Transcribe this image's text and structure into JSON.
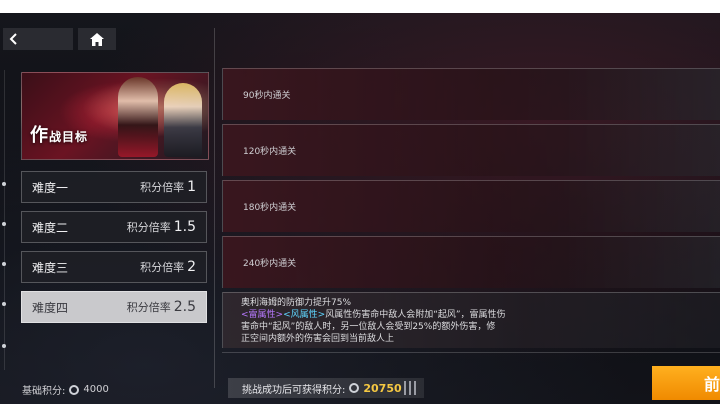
{
  "nav": {
    "back_icon": "chevron-left-icon",
    "home_icon": "home-icon"
  },
  "objective": {
    "title_big": "作",
    "title_rest": "战目标"
  },
  "difficulties": [
    {
      "name": "难度一",
      "multiplier_label": "积分倍率",
      "multiplier": "1",
      "selected": false
    },
    {
      "name": "难度二",
      "multiplier_label": "积分倍率",
      "multiplier": "1.5",
      "selected": false
    },
    {
      "name": "难度三",
      "multiplier_label": "积分倍率",
      "multiplier": "2",
      "selected": false
    },
    {
      "name": "难度四",
      "multiplier_label": "积分倍率",
      "multiplier": "2.5",
      "selected": true
    }
  ],
  "goals": [
    {
      "label": "90秒内通关"
    },
    {
      "label": "120秒内通关"
    },
    {
      "label": "180秒内通关"
    },
    {
      "label": "240秒内通关"
    }
  ],
  "description": {
    "line1": "奥利海姆的防御力提升75%",
    "tag_lightning": "<雷属性>",
    "tag_wind": "<风属性>",
    "line2_rest": "风属性伤害命中敌人会附加“起风”，雷属性伤",
    "line3": "害命中“起风”的敌人时，另一位敌人会受到25%的额外伤害，修",
    "line4": "正空间内额外的伤害会回到当前敌人上"
  },
  "footer": {
    "base_score_label": "基础积分:",
    "base_score_value": "4000",
    "reward_label": "挑战成功后可获得积分:",
    "reward_value": "20750",
    "start_label": "前"
  },
  "colors": {
    "accent": "#f5a00f",
    "reward": "#f5c842",
    "lightning": "#b779ff",
    "wind": "#5fd6ff"
  }
}
